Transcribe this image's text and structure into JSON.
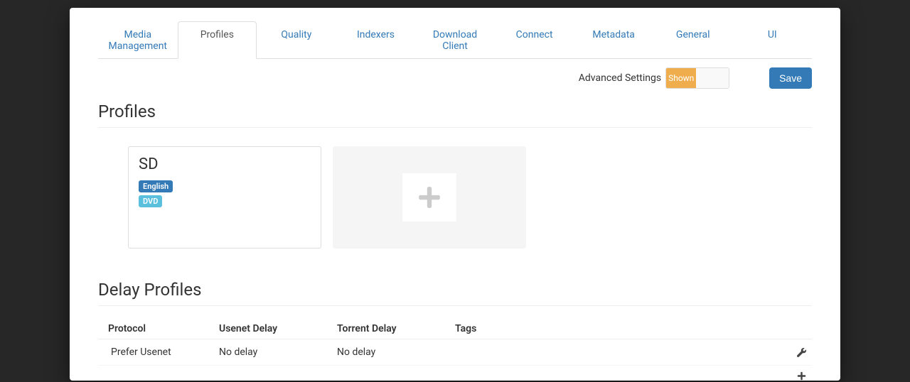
{
  "tabs": [
    {
      "label": "Media Management",
      "active": false
    },
    {
      "label": "Profiles",
      "active": true
    },
    {
      "label": "Quality",
      "active": false
    },
    {
      "label": "Indexers",
      "active": false
    },
    {
      "label": "Download Client",
      "active": false
    },
    {
      "label": "Connect",
      "active": false
    },
    {
      "label": "Metadata",
      "active": false
    },
    {
      "label": "General",
      "active": false
    },
    {
      "label": "UI",
      "active": false
    }
  ],
  "toolbar": {
    "advanced_label": "Advanced Settings",
    "toggle_shown": "Shown",
    "save_label": "Save"
  },
  "profiles": {
    "heading": "Profiles",
    "cards": [
      {
        "title": "SD",
        "language_badge": "English",
        "quality_badge": "DVD"
      }
    ]
  },
  "delay_profiles": {
    "heading": "Delay Profiles",
    "columns": {
      "protocol": "Protocol",
      "usenet_delay": "Usenet Delay",
      "torrent_delay": "Torrent Delay",
      "tags": "Tags"
    },
    "rows": [
      {
        "protocol": "Prefer Usenet",
        "usenet_delay": "No delay",
        "torrent_delay": "No delay",
        "tags": ""
      }
    ]
  }
}
